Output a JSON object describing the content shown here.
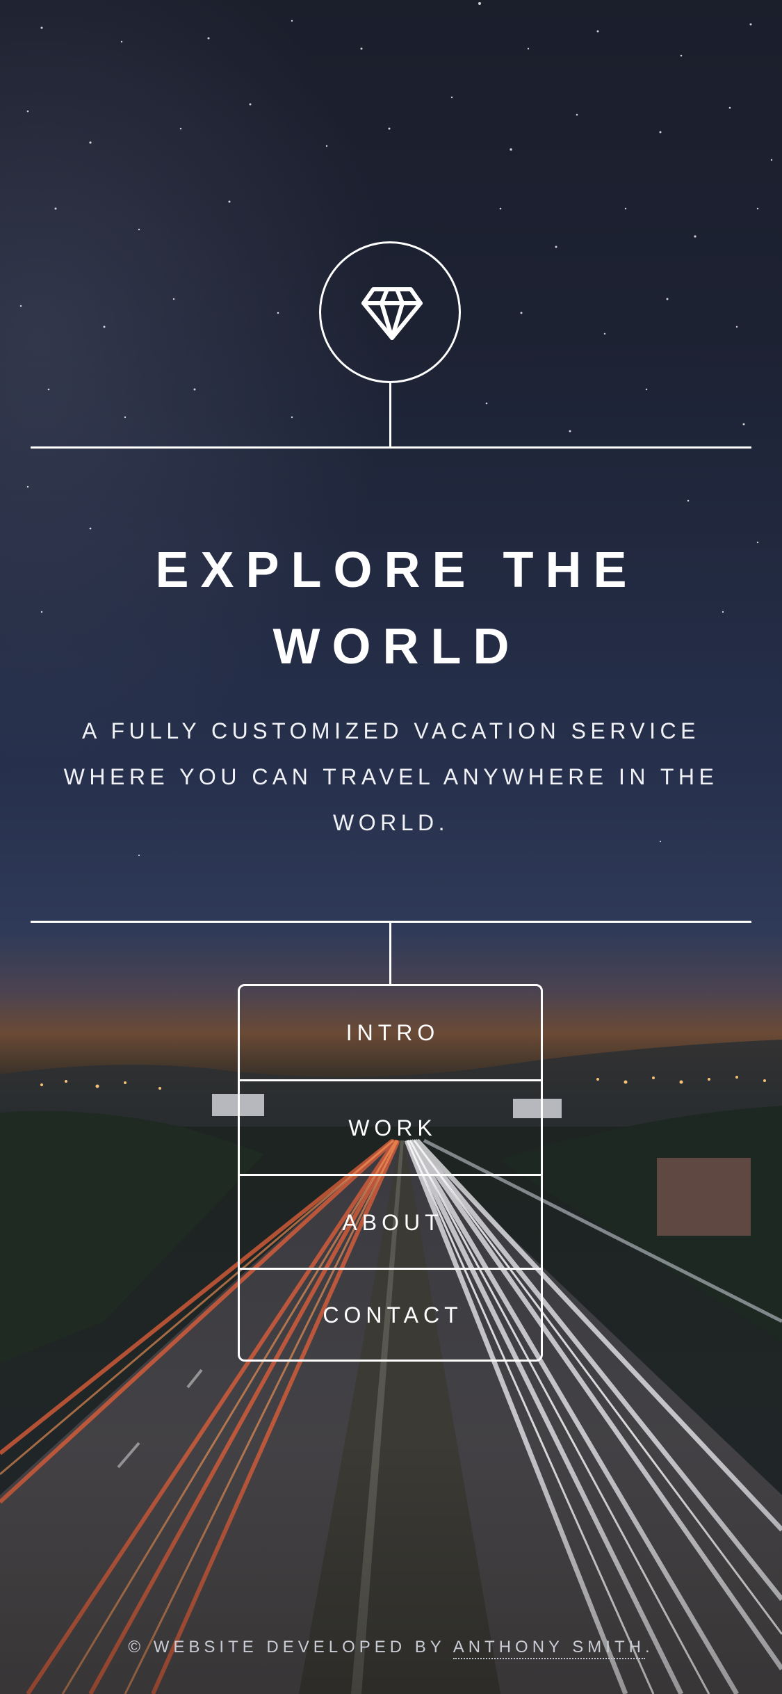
{
  "colors": {
    "text": "#ffffff",
    "sky_top": "#1b1e2b",
    "sky_mid": "#2a3554",
    "horizon": "#7a4a2c",
    "light_trail_red": "#e4603a",
    "light_trail_white": "#e9e9ee"
  },
  "header": {
    "logo_icon": "diamond-icon"
  },
  "hero": {
    "title_line1": "EXPLORE THE",
    "title_line2": "WORLD",
    "subtitle_line1": "A FULLY CUSTOMIZED VACATION SERVICE",
    "subtitle_line2": "WHERE YOU CAN TRAVEL ANYWHERE IN THE",
    "subtitle_line3": "WORLD."
  },
  "menu": {
    "items": [
      {
        "label": "INTRO"
      },
      {
        "label": "WORK"
      },
      {
        "label": "ABOUT"
      },
      {
        "label": "CONTACT"
      }
    ]
  },
  "footer": {
    "prefix": "© WEBSITE DEVELOPED BY",
    "author": "ANTHONY SMITH",
    "suffix": "."
  }
}
